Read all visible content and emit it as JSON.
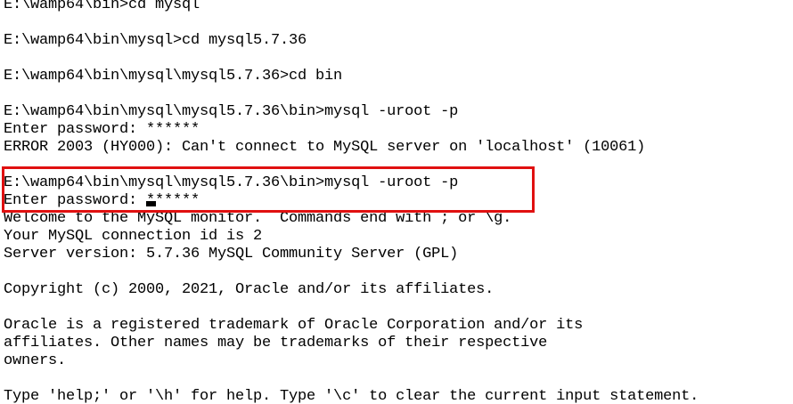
{
  "terminal": {
    "lines": [
      "E:\\wamp64\\bin>cd mysql",
      "",
      "E:\\wamp64\\bin\\mysql>cd mysql5.7.36",
      "",
      "E:\\wamp64\\bin\\mysql\\mysql5.7.36>cd bin",
      "",
      "E:\\wamp64\\bin\\mysql\\mysql5.7.36\\bin>mysql -uroot -p",
      "Enter password: ******",
      "ERROR 2003 (HY000): Can't connect to MySQL server on 'localhost' (10061)",
      "",
      "E:\\wamp64\\bin\\mysql\\mysql5.7.36\\bin>mysql -uroot -p",
      "Enter password: ******",
      "Welcome to the MySQL monitor.  Commands end with ; or \\g.",
      "Your MySQL connection id is 2",
      "Server version: 5.7.36 MySQL Community Server (GPL)",
      "",
      "Copyright (c) 2000, 2021, Oracle and/or its affiliates.",
      "",
      "Oracle is a registered trademark of Oracle Corporation and/or its",
      "affiliates. Other names may be trademarks of their respective",
      "owners.",
      "",
      "Type 'help;' or '\\h' for help. Type '\\c' to clear the current input statement."
    ]
  },
  "colors": {
    "background": "#ffffff",
    "text": "#000000",
    "highlight_border": "#e01010"
  }
}
